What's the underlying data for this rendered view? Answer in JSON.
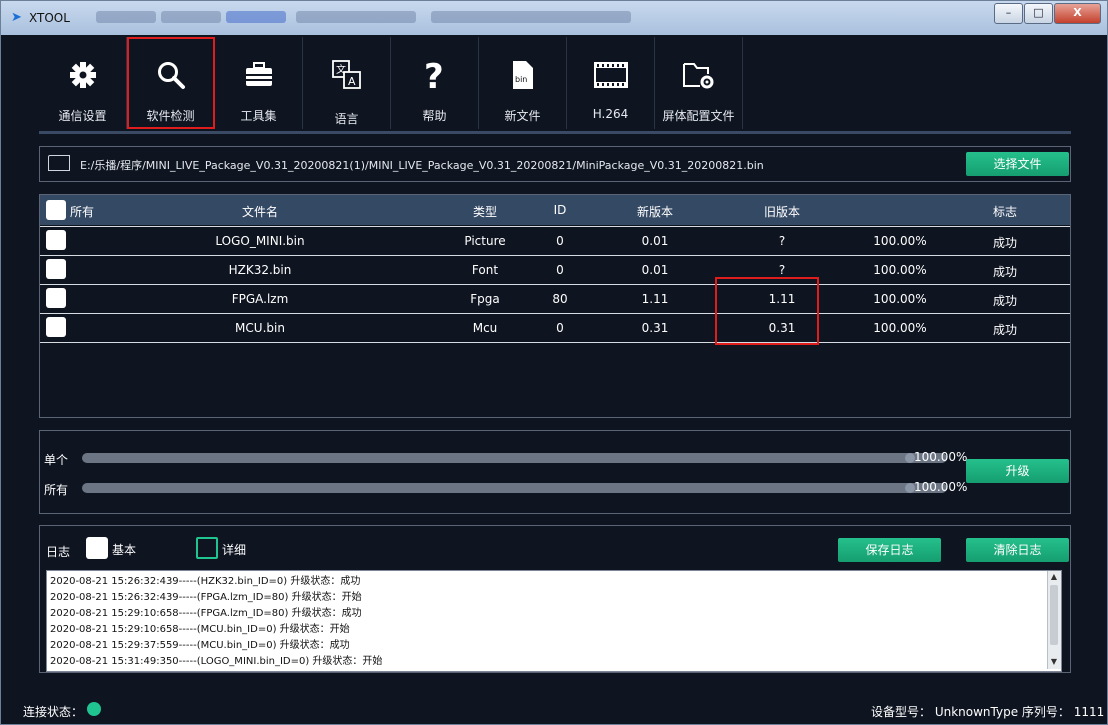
{
  "window": {
    "title": "XTOOL",
    "controls": {
      "minimize": "–",
      "maximize": "□",
      "close": "X"
    }
  },
  "toolbar": [
    {
      "icon": "gear-icon",
      "label": "通信设置"
    },
    {
      "icon": "search-icon",
      "label": "软件检测",
      "active": true
    },
    {
      "icon": "toolbox-icon",
      "label": "工具集"
    },
    {
      "icon": "translate-icon",
      "label": "语言"
    },
    {
      "icon": "help-icon",
      "label": "帮助"
    },
    {
      "icon": "bin-file-icon",
      "label": "新文件",
      "icon_text": "bin"
    },
    {
      "icon": "film-icon",
      "label": "H.264"
    },
    {
      "icon": "folder-settings-icon",
      "label": "屏体配置文件"
    }
  ],
  "file": {
    "path": "E:/乐播/程序/MINI_LIVE_Package_V0.31_20200821(1)/MINI_LIVE_Package_V0.31_20200821/MiniPackage_V0.31_20200821.bin",
    "select_button": "选择文件"
  },
  "table": {
    "headers": [
      "所有",
      "文件名",
      "类型",
      "ID",
      "新版本",
      "旧版本",
      "",
      "标志"
    ],
    "rows": [
      {
        "name": "LOGO_MINI.bin",
        "type": "Picture",
        "id": "0",
        "new": "0.01",
        "old": "?",
        "progress": "100.00%",
        "flag": "成功"
      },
      {
        "name": "HZK32.bin",
        "type": "Font",
        "id": "0",
        "new": "0.01",
        "old": "?",
        "progress": "100.00%",
        "flag": "成功"
      },
      {
        "name": "FPGA.lzm",
        "type": "Fpga",
        "id": "80",
        "new": "1.11",
        "old": "1.11",
        "progress": "100.00%",
        "flag": "成功"
      },
      {
        "name": "MCU.bin",
        "type": "Mcu",
        "id": "0",
        "new": "0.31",
        "old": "0.31",
        "progress": "100.00%",
        "flag": "成功"
      }
    ]
  },
  "progress": {
    "single_label": "单个",
    "single_value": "100.00%",
    "single_fraction": 1.0,
    "all_label": "所有",
    "all_value": "100.00%",
    "all_fraction": 1.0,
    "upgrade_button": "升级"
  },
  "log": {
    "title": "日志",
    "basic_label": "基本",
    "detail_label": "详细",
    "save_button": "保存日志",
    "clear_button": "清除日志",
    "lines": [
      "2020-08-21 15:26:32:439-----(HZK32.bin_ID=0)  升级状态：成功",
      "2020-08-21 15:26:32:439-----(FPGA.lzm_ID=80)  升级状态：开始",
      "2020-08-21 15:29:10:658-----(FPGA.lzm_ID=80)  升级状态：成功",
      "2020-08-21 15:29:10:658-----(MCU.bin_ID=0)  升级状态：开始",
      "2020-08-21 15:29:37:559-----(MCU.bin_ID=0)  升级状态：成功",
      "2020-08-21 15:31:49:350-----(LOGO_MINI.bin_ID=0)  升级状态：开始"
    ]
  },
  "status": {
    "connection_label": "连接状态：",
    "connection_color": "#1fc48f",
    "device_info": "设备型号： UnknownType 序列号： 1111"
  },
  "colors": {
    "accent": "#1fb584",
    "highlight": "#e01d1d",
    "header": "#344964"
  }
}
